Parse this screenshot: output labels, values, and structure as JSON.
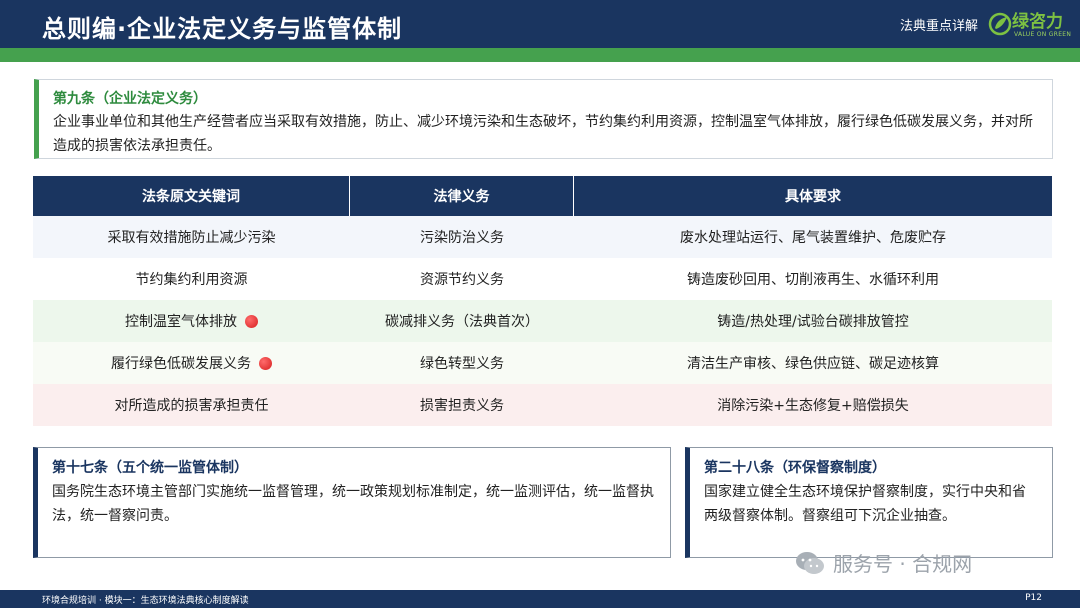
{
  "header": {
    "title": "总则编·企业法定义务与监管体制",
    "tag": "法典重点详解",
    "logo_text": "绿咨力",
    "logo_sub": "VALUE ON GREEN"
  },
  "article9": {
    "title": "第九条（企业法定义务）",
    "text": "企业事业单位和其他生产经营者应当采取有效措施，防止、减少环境污染和生态破坏，节约集约利用资源，控制温室气体排放，履行绿色低碳发展义务，并对所造成的损害依法承担责任。"
  },
  "table": {
    "headers": [
      "法条原文关键词",
      "法律义务",
      "具体要求"
    ],
    "rows": [
      {
        "keyword": "采取有效措施防止减少污染",
        "duty": "污染防治义务",
        "req": "废水处理站运行、尾气装置维护、危废贮存"
      },
      {
        "keyword": "节约集约利用资源",
        "duty": "资源节约义务",
        "req": "铸造废砂回用、切削液再生、水循环利用"
      },
      {
        "keyword": "控制温室气体排放",
        "duty": "碳减排义务（法典首次）",
        "req": "铸造/热处理/试验台碳排放管控"
      },
      {
        "keyword": "履行绿色低碳发展义务",
        "duty": "绿色转型义务",
        "req": "清洁生产审核、绿色供应链、碳足迹核算"
      },
      {
        "keyword": "对所造成的损害承担责任",
        "duty": "损害担责义务",
        "req": "消除污染+生态修复+赔偿损失"
      }
    ]
  },
  "article17": {
    "title": "第十七条（五个统一监管体制）",
    "text": "国务院生态环境主管部门实施统一监督管理，统一政策规划标准制定，统一监测评估，统一监督执法，统一督察问责。"
  },
  "article28": {
    "title": "第二十八条（环保督察制度）",
    "text": "国家建立健全生态环境保护督察制度，实行中央和省两级督察体制。督察组可下沉企业抽查。"
  },
  "watermark": "服务号 · 合规网",
  "footer": {
    "left": "环境合规培训 · 模块一：生态环境法典核心制度解读",
    "page": "P12"
  },
  "colors": {
    "navy": "#1a3560",
    "green": "#45a14e",
    "highlight_dot": "#d61f1f"
  }
}
